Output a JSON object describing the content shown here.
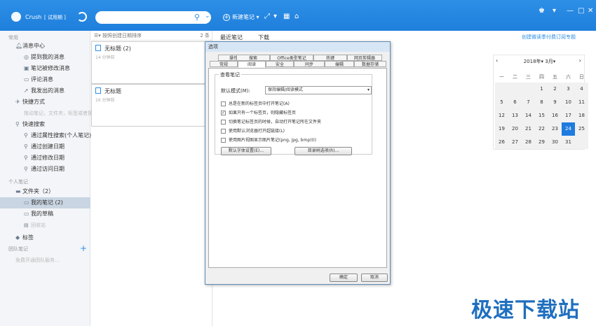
{
  "app": {
    "username": "Crush",
    "trial_label": "[ 试用期 ]",
    "search_placeholder": "",
    "new_note_label": "新建笔记"
  },
  "sidebar": {
    "common_header": "常用",
    "items": [
      {
        "label": "消息中心",
        "icon": "bell-icon"
      },
      {
        "label": "提到我的消息",
        "icon": "at-icon"
      },
      {
        "label": "笔记被修改消息",
        "icon": "edit-icon"
      },
      {
        "label": "评论消息",
        "icon": "comment-icon"
      },
      {
        "label": "我发出的消息",
        "icon": "send-icon"
      },
      {
        "label": "快捷方式",
        "icon": "shortcut-icon"
      },
      {
        "label": "拖动笔记，文件夹，标签或者搜",
        "icon": ""
      },
      {
        "label": "快速搜索",
        "icon": "search-icon"
      },
      {
        "label": "通过属性搜索(个人笔记)",
        "icon": "search-icon"
      },
      {
        "label": "通过创建日期",
        "icon": "search-icon"
      },
      {
        "label": "通过修改日期",
        "icon": "search-icon"
      },
      {
        "label": "通过访问日期",
        "icon": "search-icon"
      }
    ],
    "personal_header": "个人笔记",
    "folders": [
      {
        "label": "文件夹（2）",
        "icon": "folder-icon"
      },
      {
        "label": "我的笔记 (2)",
        "icon": "folder-icon"
      },
      {
        "label": "我的草稿",
        "icon": "folder-icon"
      },
      {
        "label": "回收站",
        "icon": "trash-icon"
      }
    ],
    "tags_label": "标签",
    "team_header": "团队笔记",
    "team_hint": "免费开通团队服务..."
  },
  "notelist": {
    "sort_label": "按照创建日期排序",
    "count": "2 条",
    "notes": [
      {
        "title": "无标题 (2)",
        "time": "14 分钟前"
      },
      {
        "title": "无标题",
        "time": "16 分钟前"
      }
    ]
  },
  "rightpane": {
    "tabs": [
      "最近笔记",
      "下载"
    ],
    "wechat_link": "创建微读季付费订阅专题"
  },
  "calendar": {
    "year": "2018年",
    "month": "3月",
    "weekdays": [
      "一",
      "二",
      "三",
      "四",
      "五",
      "六",
      "日"
    ],
    "rows": [
      [
        "",
        "",
        "",
        "1",
        "2",
        "3",
        "4"
      ],
      [
        "5",
        "6",
        "7",
        "8",
        "9",
        "10",
        "11"
      ],
      [
        "12",
        "13",
        "14",
        "15",
        "16",
        "17",
        "18"
      ],
      [
        "19",
        "20",
        "21",
        "22",
        "23",
        "24",
        "25"
      ],
      [
        "26",
        "27",
        "28",
        "29",
        "30",
        "31",
        ""
      ]
    ],
    "today": "24"
  },
  "dialog": {
    "title": "选项",
    "tabs_row1": [
      "操作",
      "搜索",
      "Office类型笔记",
      "热键",
      "网页剪辑器"
    ],
    "tabs_row2": [
      "常规",
      "阅读",
      "安全",
      "同步",
      "编辑",
      "数据存储"
    ],
    "active_tab": "阅读",
    "group_label": "查看笔记",
    "mode_label": "默认模式(M):",
    "mode_value": "保持编辑/阅读模式",
    "checkboxes": [
      {
        "label": "总是在新的标签页中打开笔记(A)",
        "checked": false
      },
      {
        "label": "如果只有一个标签页，则隐藏标签页",
        "checked": true
      },
      {
        "label": "切换笔记标签页的时候，自动打开笔记所在文件夹",
        "checked": false
      },
      {
        "label": "使用默认浏览器打开超链接(L)",
        "checked": false
      },
      {
        "label": "使用图片视图显示图片笔记(png, jpg, bmp)(I)",
        "checked": false
      }
    ],
    "font_btn": "默认字体设置(E)...",
    "tree_btn": "目录树选项(R)...",
    "ok_btn": "确定",
    "cancel_btn": "取消"
  },
  "watermark": "极速下载站"
}
